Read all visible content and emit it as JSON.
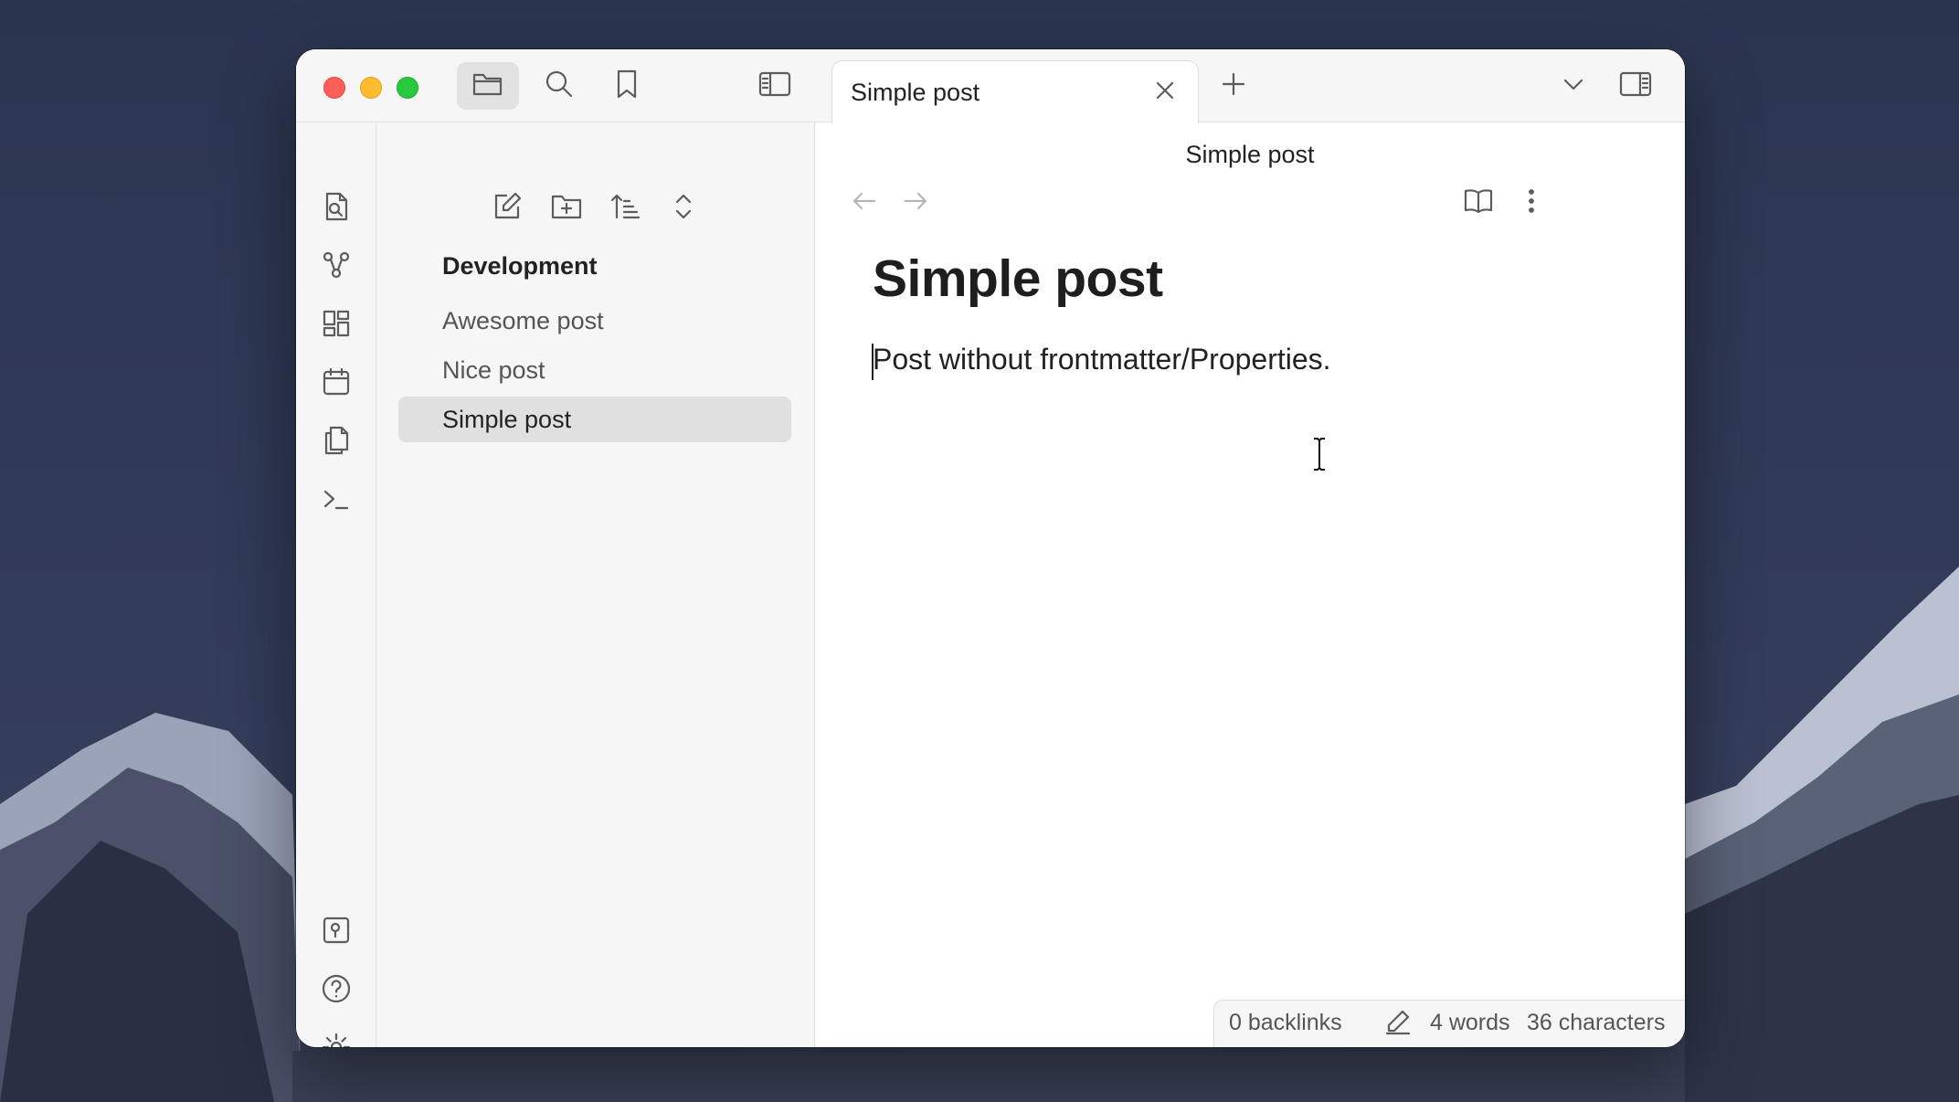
{
  "window": {
    "traffic_lights": [
      "close",
      "minimize",
      "zoom"
    ]
  },
  "sidebar_tabs": [
    {
      "name": "files",
      "icon": "folder-icon",
      "active": true
    },
    {
      "name": "search",
      "icon": "search-icon",
      "active": false
    },
    {
      "name": "bookmarks",
      "icon": "bookmark-icon",
      "active": false
    }
  ],
  "ribbon": {
    "top_icons": [
      "switcher-icon",
      "graph-icon",
      "canvas-icon",
      "daily-notes-icon",
      "templates-icon",
      "command-palette-icon"
    ],
    "bottom_icons": [
      "vault-switcher-icon",
      "help-icon",
      "settings-icon"
    ]
  },
  "file_explorer": {
    "actions": [
      "new-note-icon",
      "new-folder-icon",
      "sort-icon",
      "collapse-expand-icon"
    ],
    "folder": "Development",
    "files": [
      {
        "label": "Awesome post",
        "active": false
      },
      {
        "label": "Nice post",
        "active": false
      },
      {
        "label": "Simple post",
        "active": true
      }
    ]
  },
  "tabs": [
    {
      "label": "Simple post",
      "active": true
    }
  ],
  "view_header": {
    "title": "Simple post"
  },
  "document": {
    "title": "Simple post",
    "body": "Post without frontmatter/Properties."
  },
  "status_bar": {
    "backlinks": "0 backlinks",
    "words": "4 words",
    "characters": "36 characters"
  },
  "colors": {
    "traffic_red": "#fe5f57",
    "traffic_yellow": "#febc2e",
    "traffic_green": "#28c840",
    "active_item_bg": "#e0e0e0"
  }
}
